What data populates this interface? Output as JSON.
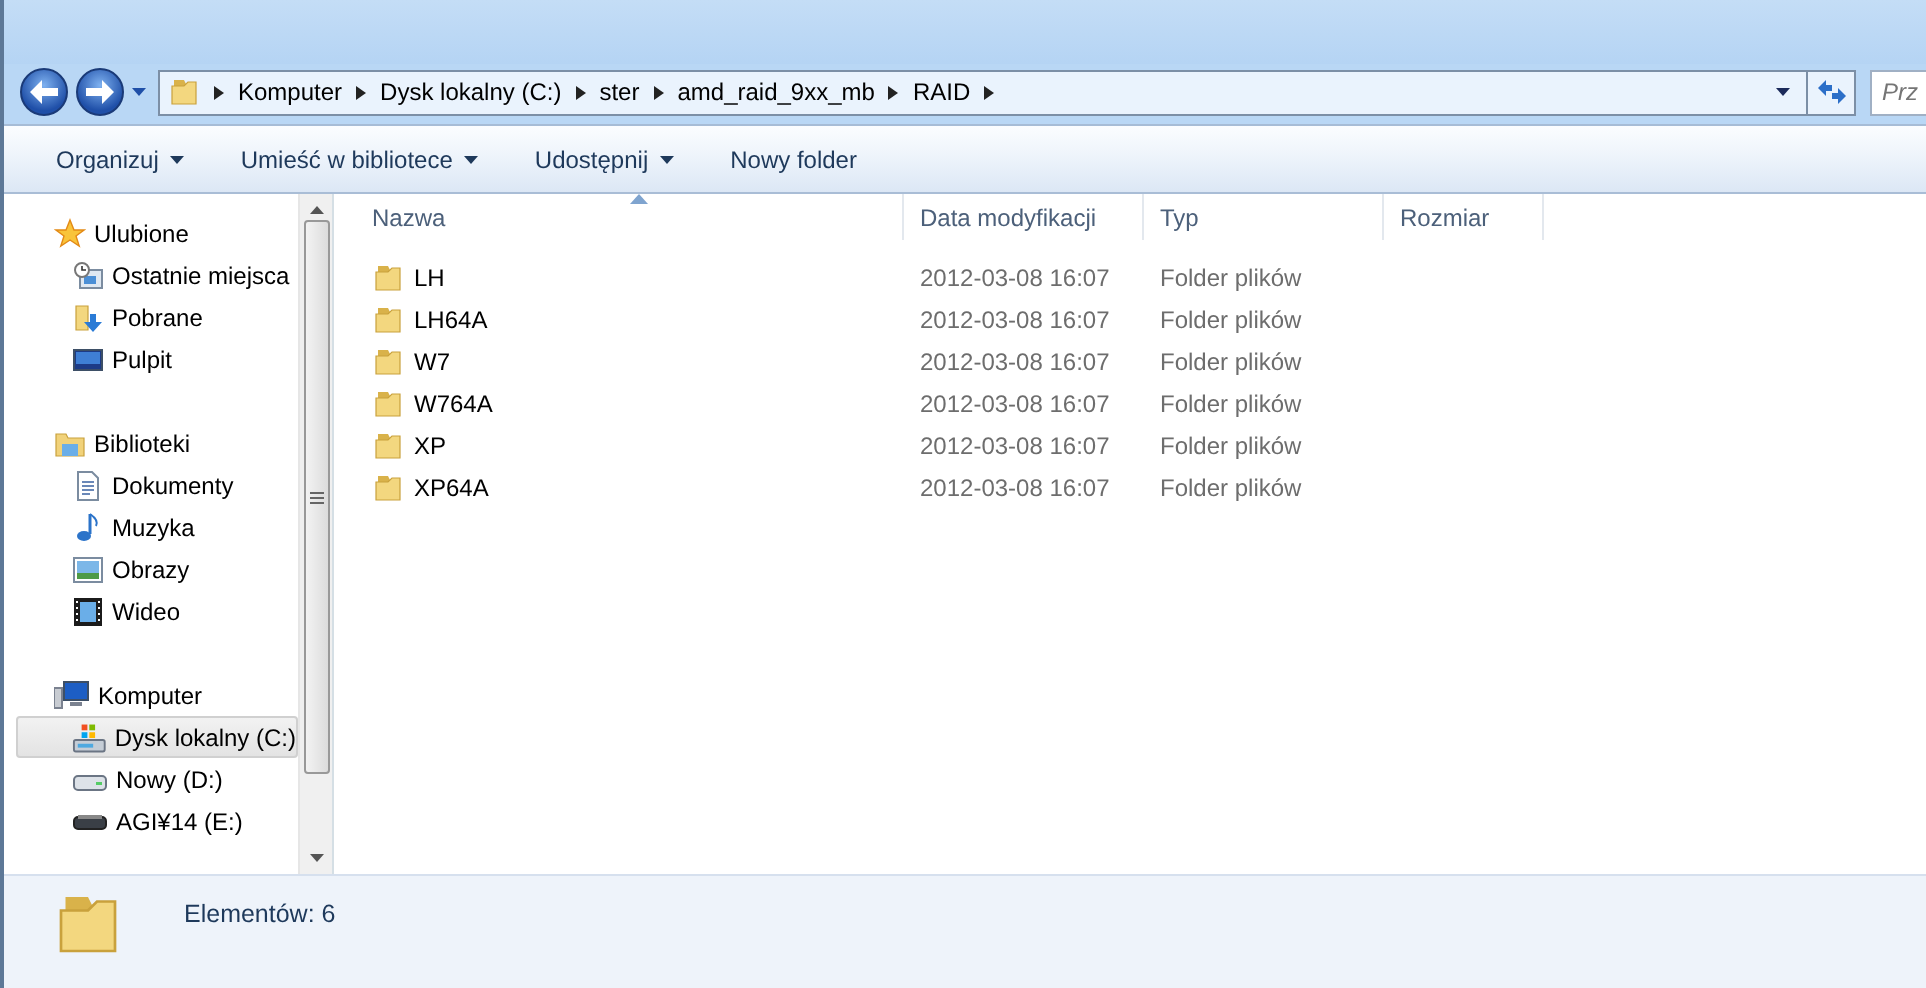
{
  "address": {
    "crumbs": [
      "Komputer",
      "Dysk lokalny (C:)",
      "ster",
      "amd_raid_9xx_mb",
      "RAID"
    ]
  },
  "search": {
    "placeholder": "Prz"
  },
  "toolbar": [
    {
      "label": "Organizuj",
      "menu": true
    },
    {
      "label": "Umieść w bibliotece",
      "menu": true
    },
    {
      "label": "Udostępnij",
      "menu": true
    },
    {
      "label": "Nowy folder",
      "menu": false
    }
  ],
  "nav": {
    "groups": [
      {
        "label": "Ulubione",
        "kind": "favorites",
        "selected": false,
        "children": [
          {
            "label": "Ostatnie miejsca",
            "kind": "recent",
            "selected": false
          },
          {
            "label": "Pobrane",
            "kind": "downloads",
            "selected": false
          },
          {
            "label": "Pulpit",
            "kind": "desktop",
            "selected": false
          }
        ]
      },
      {
        "label": "Biblioteki",
        "kind": "libraries",
        "selected": false,
        "children": [
          {
            "label": "Dokumenty",
            "kind": "documents",
            "selected": false
          },
          {
            "label": "Muzyka",
            "kind": "music",
            "selected": false
          },
          {
            "label": "Obrazy",
            "kind": "pictures",
            "selected": false
          },
          {
            "label": "Wideo",
            "kind": "video",
            "selected": false
          }
        ]
      },
      {
        "label": "Komputer",
        "kind": "computer",
        "selected": false,
        "children": [
          {
            "label": "Dysk lokalny (C:)",
            "kind": "system-drive",
            "selected": true
          },
          {
            "label": "Nowy (D:)",
            "kind": "drive",
            "selected": false
          },
          {
            "label": "AGI¥14 (E:)",
            "kind": "removable",
            "selected": false
          }
        ]
      }
    ]
  },
  "table": {
    "columns": [
      {
        "label": "Nazwa",
        "sorted": true
      },
      {
        "label": "Data modyfikacji",
        "sorted": false
      },
      {
        "label": "Typ",
        "sorted": false
      },
      {
        "label": "Rozmiar",
        "sorted": false
      }
    ],
    "rows": [
      {
        "name": "LH",
        "modified": "2012-03-08 16:07",
        "type": "Folder plików",
        "selected": false
      },
      {
        "name": "LH64A",
        "modified": "2012-03-08 16:07",
        "type": "Folder plików",
        "selected": false
      },
      {
        "name": "W7",
        "modified": "2012-03-08 16:07",
        "type": "Folder plików",
        "selected": false
      },
      {
        "name": "W764A",
        "modified": "2012-03-08 16:07",
        "type": "Folder plików",
        "selected": false
      },
      {
        "name": "XP",
        "modified": "2012-03-08 16:07",
        "type": "Folder plików",
        "selected": false
      },
      {
        "name": "XP64A",
        "modified": "2012-03-08 16:07",
        "type": "Folder plików",
        "selected": false
      }
    ]
  },
  "status_bar": {
    "count": "Elementów: 6"
  }
}
